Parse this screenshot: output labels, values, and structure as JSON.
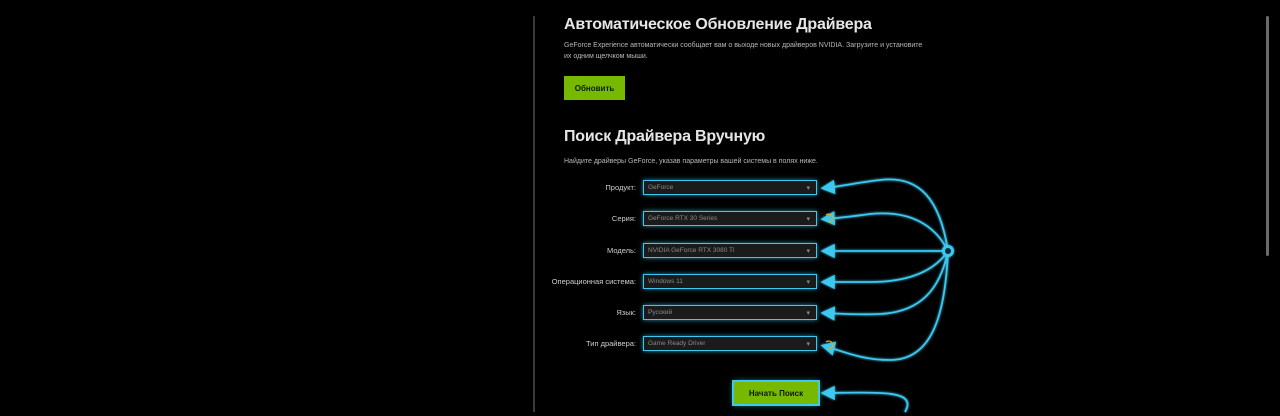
{
  "auto_update": {
    "title": "Автоматическое Обновление Драйвера",
    "description": "GeForce Experience автоматически сообщает вам о выходе новых драйверов NVIDIA. Загрузите и установите их одним щелчком мыши.",
    "button_label": "Обновить"
  },
  "manual_search": {
    "title": "Поиск Драйвера Вручную",
    "description": "Найдите драйверы GeForce, указав параметры вашей системы в полях ниже.",
    "fields": [
      {
        "label": "Продукт:",
        "value": "GeForce"
      },
      {
        "label": "Серия:",
        "value": "GeForce RTX 30 Series"
      },
      {
        "label": "Модель:",
        "value": "NVIDIA GeForce RTX 3080 Ti"
      },
      {
        "label": "Операционная система:",
        "value": "Windows 11"
      },
      {
        "label": "Язык:",
        "value": "Русский"
      },
      {
        "label": "Тип драйвера:",
        "value": "Game Ready Driver"
      }
    ],
    "search_button_label": "Начать Поиск"
  },
  "colors": {
    "accent_green": "#76b900",
    "highlight_blue": "#3cc8f0",
    "cursor_yellow": "#d8b020"
  }
}
